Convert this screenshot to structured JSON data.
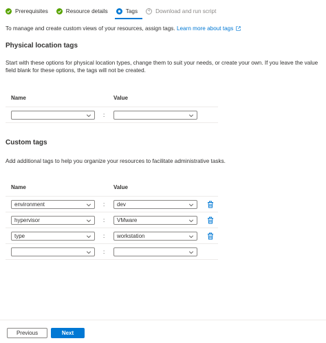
{
  "wizard": {
    "steps": [
      {
        "label": "Prerequisites",
        "state": "done"
      },
      {
        "label": "Resource details",
        "state": "done"
      },
      {
        "label": "Tags",
        "state": "current"
      },
      {
        "label": "Download and run script",
        "state": "pending",
        "number": "4"
      }
    ]
  },
  "intro": {
    "text": "To manage and create custom views of your resources, assign tags.",
    "link": "Learn more about tags"
  },
  "physical": {
    "title": "Physical location tags",
    "description": "Start with these options for physical location types, change them to suit your needs, or create your own. If you leave the value field blank for these options, the tags will not be created.",
    "name_header": "Name",
    "value_header": "Value",
    "rows": [
      {
        "name": "",
        "value": ""
      }
    ]
  },
  "custom": {
    "title": "Custom tags",
    "description": "Add additional tags to help you organize your resources to facilitate administrative tasks.",
    "name_header": "Name",
    "value_header": "Value",
    "rows": [
      {
        "name": "environment",
        "value": "dev"
      },
      {
        "name": "hypervisor",
        "value": "VMware"
      },
      {
        "name": "type",
        "value": "workstation"
      },
      {
        "name": "",
        "value": ""
      }
    ]
  },
  "separator": ":",
  "footer": {
    "previous_label": "Previous",
    "next_label": "Next"
  },
  "colors": {
    "accent": "#0078d4",
    "success": "#57a300"
  }
}
